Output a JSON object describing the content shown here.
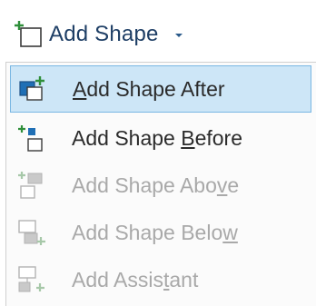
{
  "ribbon": {
    "button_label": "Add Shape",
    "icon": "add-shape-icon",
    "caret_icon": "chevron-down-icon",
    "label_color": "#1f3f66"
  },
  "menu": {
    "highlight_color": "#cde6f7",
    "highlight_border": "#7ab7e3",
    "items": [
      {
        "pre": "",
        "u": "A",
        "post": "dd Shape After",
        "icon": "add-shape-after-icon",
        "enabled": true,
        "highlighted": true
      },
      {
        "pre": "Add Shape ",
        "u": "B",
        "post": "efore",
        "icon": "add-shape-before-icon",
        "enabled": true,
        "highlighted": false
      },
      {
        "pre": "Add Shape Abo",
        "u": "v",
        "post": "e",
        "icon": "add-shape-above-icon",
        "enabled": false,
        "highlighted": false
      },
      {
        "pre": "Add Shape Belo",
        "u": "w",
        "post": "",
        "icon": "add-shape-below-icon",
        "enabled": false,
        "highlighted": false
      },
      {
        "pre": "Add Assis",
        "u": "t",
        "post": "ant",
        "icon": "add-assistant-icon",
        "enabled": false,
        "highlighted": false
      }
    ]
  }
}
